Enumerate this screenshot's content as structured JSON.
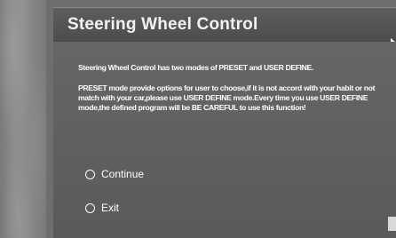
{
  "dialog": {
    "title": "Steering Wheel Control",
    "paragraph1": "Steering Wheel Control has two modes of PRESET and USER DEFINE.",
    "paragraph2": "PRESET mode provide options for user to choose,if it is not accord with your habit or not match with your car,please use USER DEFINE mode.Every time you use USER DEFINE mode,the defined program will be BE CAREFUL to use this function!",
    "options": [
      {
        "label": "Continue"
      },
      {
        "label": "Exit"
      }
    ]
  }
}
